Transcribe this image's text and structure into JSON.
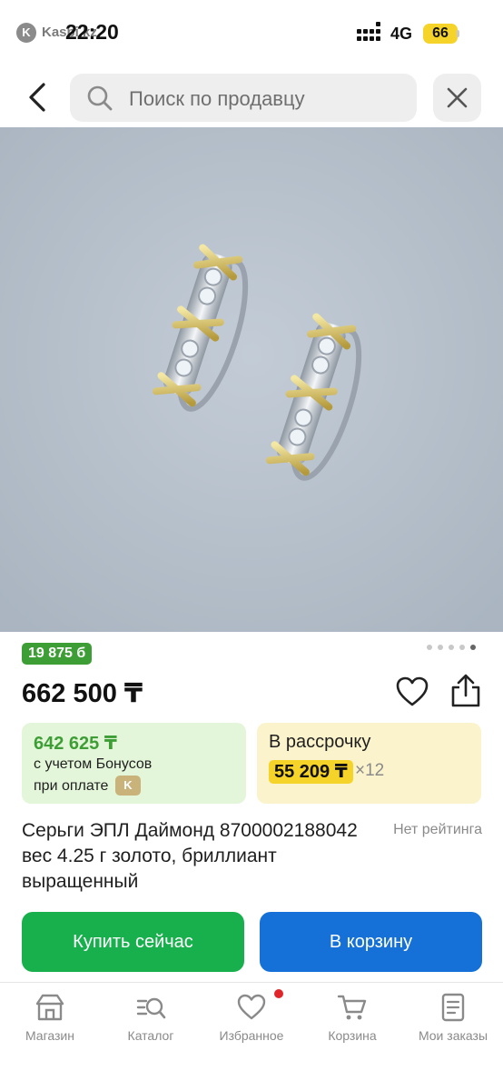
{
  "status_bar": {
    "app_name": "Kaspi.kz",
    "time": "22:20",
    "network": "4G",
    "battery": "66"
  },
  "search": {
    "placeholder": "Поиск по продавцу"
  },
  "gallery": {
    "pages": 5,
    "active_page": 5
  },
  "product": {
    "bonus_badge": "19 875 б",
    "price": "662 500 ₸",
    "bonus_card": {
      "price": "642 625 ₸",
      "line1": "с учетом Бонусов",
      "line2": "при оплате",
      "kaspi_badge": "K"
    },
    "installment_card": {
      "title": "В рассрочку",
      "amount": "55 209 ₸",
      "months": "×12"
    },
    "title": "Серьги ЭПЛ Даймонд 8700002188042 вес 4.25 г золото, бриллиант выращенный",
    "rating": "Нет рейтинга"
  },
  "actions": {
    "buy_now": "Купить сейчас",
    "add_to_cart": "В корзину"
  },
  "bottom_nav": {
    "items": [
      {
        "label": "Магазин",
        "icon": "store-icon"
      },
      {
        "label": "Каталог",
        "icon": "catalog-icon"
      },
      {
        "label": "Избранное",
        "icon": "heart-icon"
      },
      {
        "label": "Корзина",
        "icon": "cart-icon"
      },
      {
        "label": "Мои заказы",
        "icon": "orders-icon"
      }
    ]
  },
  "colors": {
    "green": "#3e9e36",
    "buy_green": "#18b04d",
    "blue": "#1571d8",
    "yellow": "#f5d329"
  }
}
